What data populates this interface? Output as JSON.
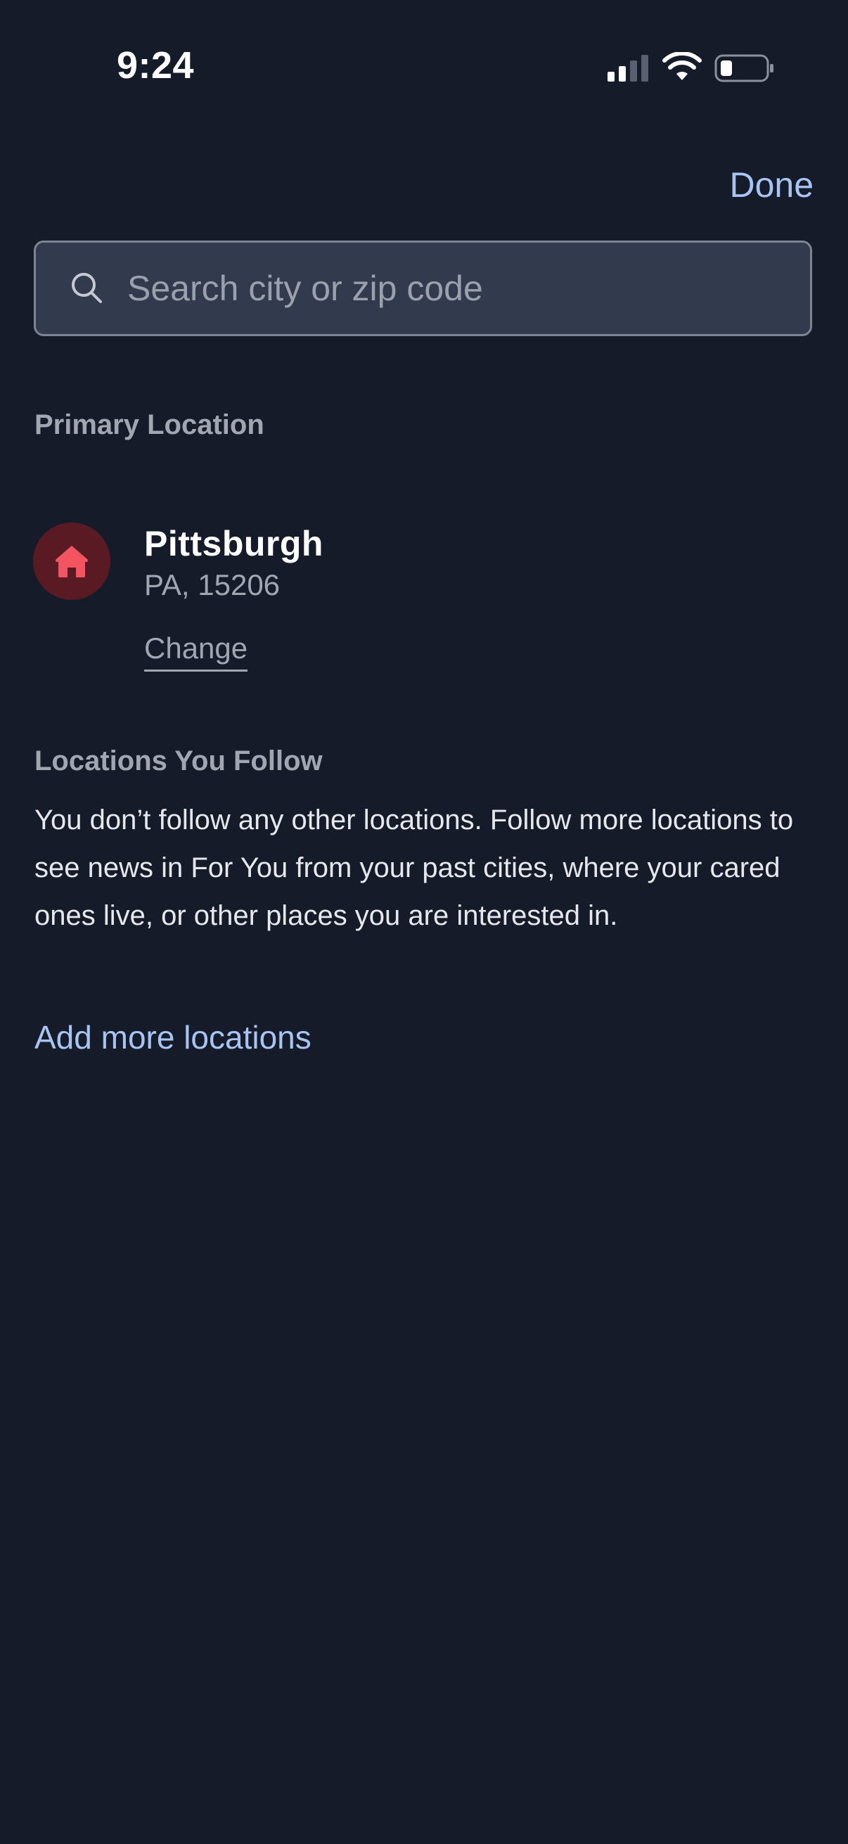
{
  "status_bar": {
    "time": "9:24"
  },
  "header": {
    "done_label": "Done"
  },
  "search": {
    "placeholder": "Search city or zip code",
    "value": ""
  },
  "primary_location": {
    "section_title": "Primary Location",
    "icon": "home-icon",
    "city": "Pittsburgh",
    "detail": "PA, 15206",
    "change_label": "Change",
    "badge_color": "#5a1a23",
    "icon_color": "#f2555f"
  },
  "followed_locations": {
    "section_title": "Locations You Follow",
    "empty_message": "You don’t follow any other locations. Follow more locations to see news in For You from your past cities, where your cared ones live, or other places you are interested in.",
    "add_label": "Add more locations"
  },
  "colors": {
    "background": "#161b2a",
    "accent": "#a7c4f2"
  }
}
